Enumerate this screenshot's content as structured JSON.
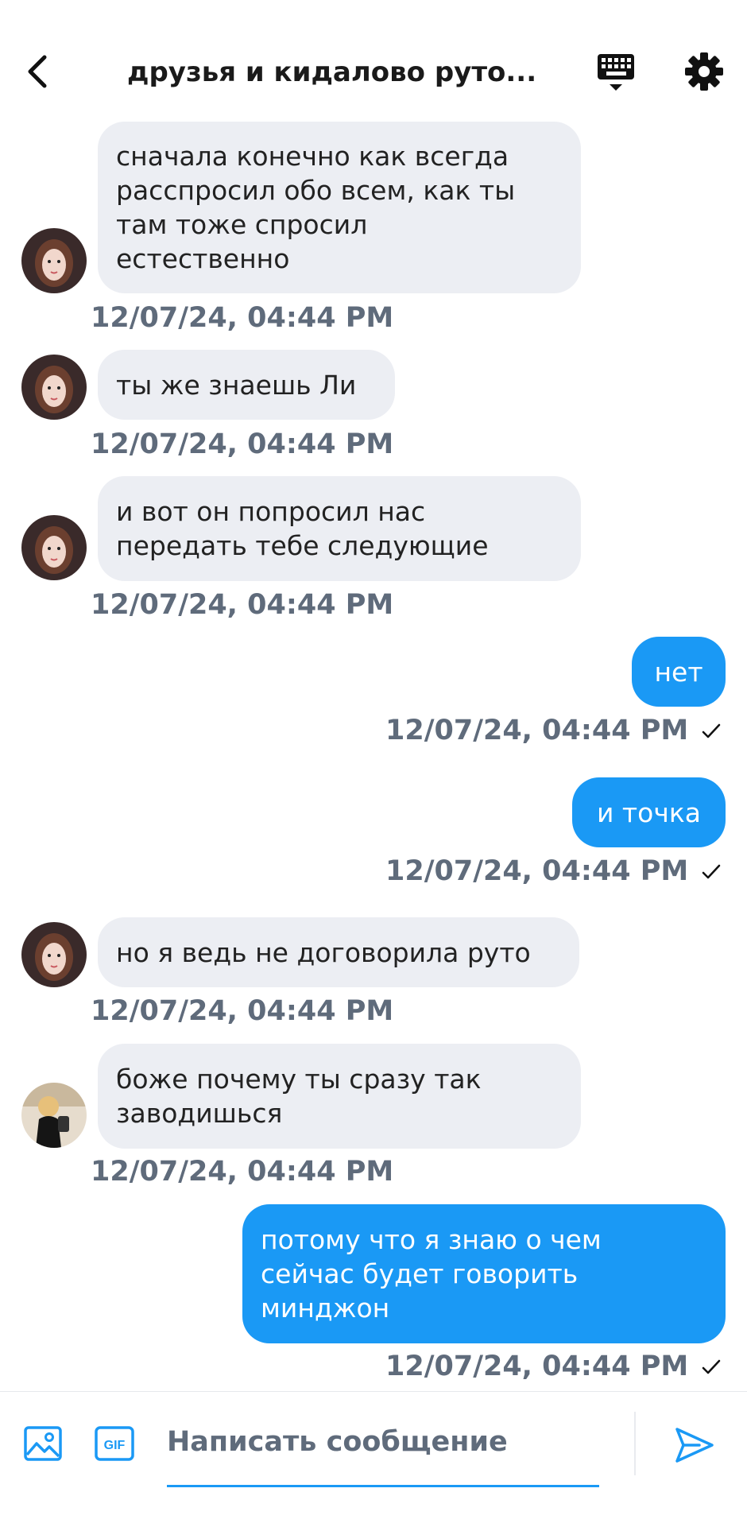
{
  "header": {
    "title": "друзья и кидалово руто..."
  },
  "icons": {
    "back": "chevron-left-icon",
    "keyboard": "keyboard-icon",
    "settings": "gear-icon",
    "image": "image-icon",
    "gif": "gif-icon",
    "send": "send-icon",
    "read": "check-icon"
  },
  "colors": {
    "outgoing_bubble": "#1a99f5",
    "incoming_bubble": "#eceef3",
    "timestamp": "#5f6b7b",
    "accent": "#1a99f5"
  },
  "messages": [
    {
      "direction": "in",
      "lines": [
        "сначала конечно как всегда",
        "расспросил обо всем, как ты",
        "там тоже спросил",
        "естественно"
      ],
      "time": "12/07/24, 04:44 PM"
    },
    {
      "direction": "in",
      "lines": [
        "ты же знаешь Ли"
      ],
      "time": "12/07/24, 04:44 PM"
    },
    {
      "direction": "in",
      "lines": [
        "и вот он попросил нас",
        "передать тебе следующие"
      ],
      "time": "12/07/24, 04:44 PM"
    },
    {
      "direction": "out",
      "lines": [
        "нет"
      ],
      "time": "12/07/24, 04:44 PM"
    },
    {
      "direction": "out",
      "lines": [
        "и точка"
      ],
      "time": "12/07/24, 04:44 PM"
    },
    {
      "direction": "in",
      "lines": [
        "но я ведь не договорила руто"
      ],
      "time": "12/07/24, 04:44 PM"
    },
    {
      "direction": "in",
      "lines": [
        "боже почему ты сразу так",
        "заводишься"
      ],
      "time": "12/07/24, 04:44 PM"
    },
    {
      "direction": "out",
      "lines": [
        "потому что я знаю о чем",
        "сейчас будет говорить",
        "минджон"
      ],
      "time": "12/07/24, 04:44 PM"
    }
  ],
  "composer": {
    "placeholder": "Написать сообщение",
    "gif_label": "GIF"
  }
}
